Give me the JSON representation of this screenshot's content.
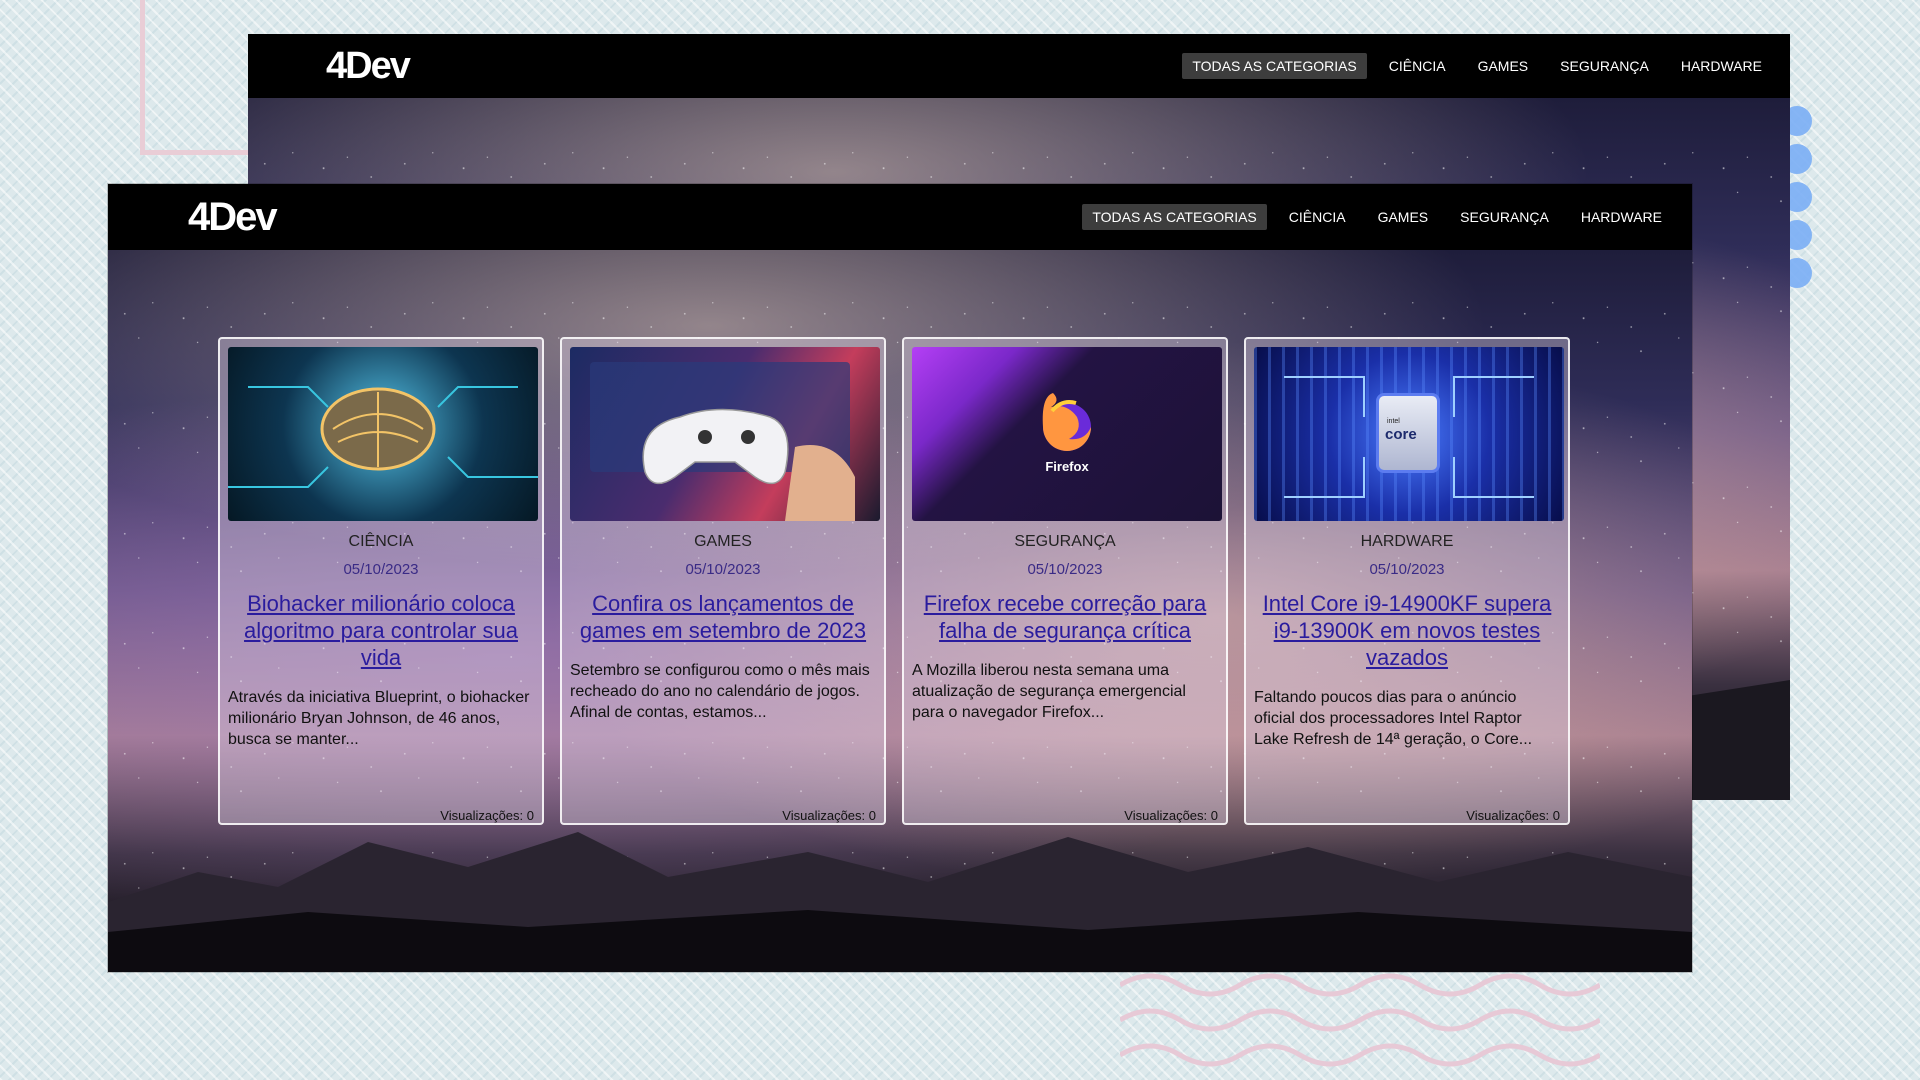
{
  "brand": {
    "logo": "4Dev"
  },
  "nav": {
    "items": [
      {
        "label": "TODAS AS CATEGORIAS",
        "active": true
      },
      {
        "label": "CIÊNCIA",
        "active": false
      },
      {
        "label": "GAMES",
        "active": false
      },
      {
        "label": "SEGURANÇA",
        "active": false
      },
      {
        "label": "HARDWARE",
        "active": false
      }
    ]
  },
  "posts": [
    {
      "category": "CIÊNCIA",
      "date": "05/10/2023",
      "title": "Biohacker milionário coloca algoritmo para controlar sua vida",
      "excerpt": "Através da iniciativa Blueprint, o biohacker milionário Bryan Johnson, de 46 anos, busca se manter...",
      "views": "Visualizações: 0"
    },
    {
      "category": "GAMES",
      "date": "05/10/2023",
      "title": "Confira os lançamentos de games em setembro de 2023",
      "excerpt": "Setembro se configurou como o mês mais recheado do ano no calendário de jogos. Afinal de contas, estamos...",
      "views": "Visualizações: 0"
    },
    {
      "category": "SEGURANÇA",
      "date": "05/10/2023",
      "title": "Firefox recebe correção para falha de segurança crítica",
      "excerpt": "A Mozilla liberou nesta semana uma atualização de segurança emergencial para o navegador Firefox...",
      "views": "Visualizações: 0",
      "thumb_text": "Firefox"
    },
    {
      "category": "HARDWARE",
      "date": "05/10/2023",
      "title": "Intel Core i9-14900KF supera i9-13900K em novos testes vazados",
      "excerpt": "Faltando poucos dias para o anúncio oficial dos processadores Intel Raptor Lake Refresh de 14ª geração, o Core...",
      "views": "Visualizações: 0",
      "thumb_text_small": "intel",
      "thumb_text": "core"
    }
  ],
  "colors": {
    "nav_bg": "#000000",
    "active_tab_bg": "#3d3d3d",
    "link": "#2a1c9e",
    "date": "#3a2b86"
  }
}
